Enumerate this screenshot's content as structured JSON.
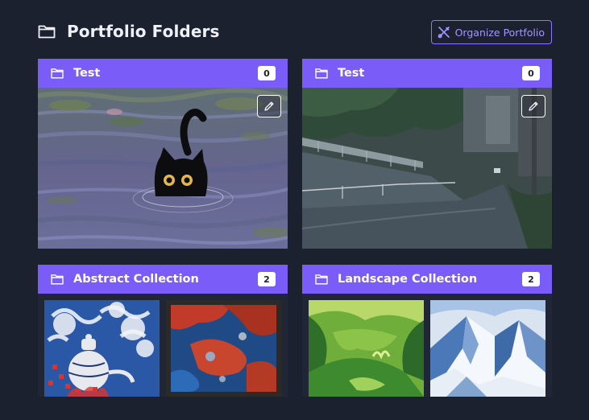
{
  "header": {
    "title": "Portfolio Folders",
    "organize_label": "Organize Portfolio"
  },
  "folders": [
    {
      "name": "Test",
      "count": "0"
    },
    {
      "name": "Test",
      "count": "0"
    },
    {
      "name": "Abstract Collection",
      "count": "2"
    },
    {
      "name": "Landscape Collection",
      "count": "2"
    }
  ],
  "colors": {
    "background": "#1c2130",
    "accent": "#7a5cf8",
    "accent_outline": "#8a76ff"
  },
  "icons": [
    "folder-icon",
    "tools-icon",
    "pencil-icon"
  ]
}
